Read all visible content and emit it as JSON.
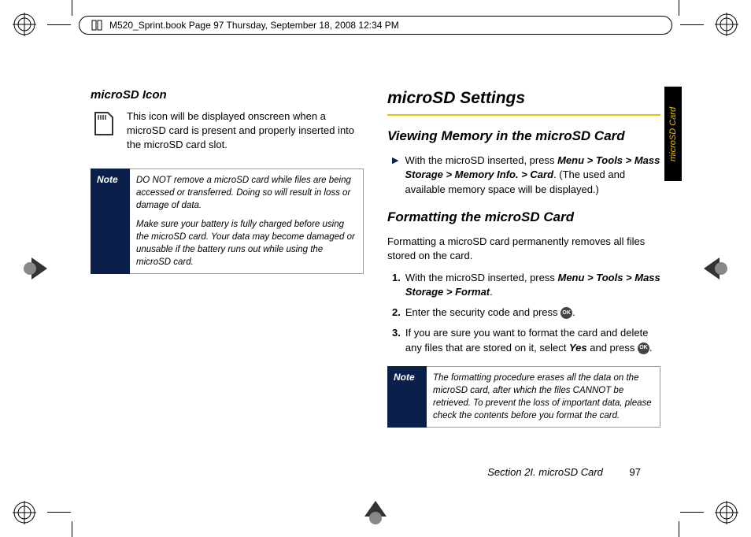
{
  "header": {
    "text": "M520_Sprint.book  Page 97  Thursday, September 18, 2008  12:34 PM"
  },
  "sideTab": "microSD Card",
  "left": {
    "heading": "microSD Icon",
    "iconText": "This icon will be displayed onscreen when a microSD card is present and properly inserted into the microSD card slot.",
    "noteLabel": "Note",
    "noteP1": "DO NOT remove a microSD card while files are being accessed or transferred. Doing so will result in loss or damage of data.",
    "noteP2": "Make sure your battery is fully charged before using the microSD card. Your data may become damaged or unusable if the battery runs out while using the microSD card."
  },
  "right": {
    "h1": "microSD Settings",
    "h2a": "Viewing Memory in the microSD Card",
    "bullet_pre": "With the microSD inserted, press ",
    "bullet_path": "Menu > Tools > Mass Storage > Memory Info. > Card",
    "bullet_post": ". (The used and available memory space will be displayed.)",
    "h2b": "Formatting the microSD Card",
    "intro": "Formatting a microSD card permanently removes all files stored on the card.",
    "step1_pre": "With the microSD inserted, press ",
    "step1_path": "Menu > Tools > Mass Storage > Format",
    "step1_post": ".",
    "step2_pre": "Enter the security code and press ",
    "step2_post": ".",
    "step3_pre": "If you are sure you want to format the card and delete any files that are stored on it, select ",
    "step3_yes": "Yes",
    "step3_mid": " and press ",
    "step3_post": ".",
    "noteLabel": "Note",
    "noteText": "The formatting procedure erases all the data on the microSD card, after which the files CANNOT be retrieved. To prevent the loss of important data, please check the contents before you format the card."
  },
  "footer": {
    "section": "Section 2I. microSD Card",
    "page": "97"
  },
  "icons": {
    "ok": "OK"
  }
}
